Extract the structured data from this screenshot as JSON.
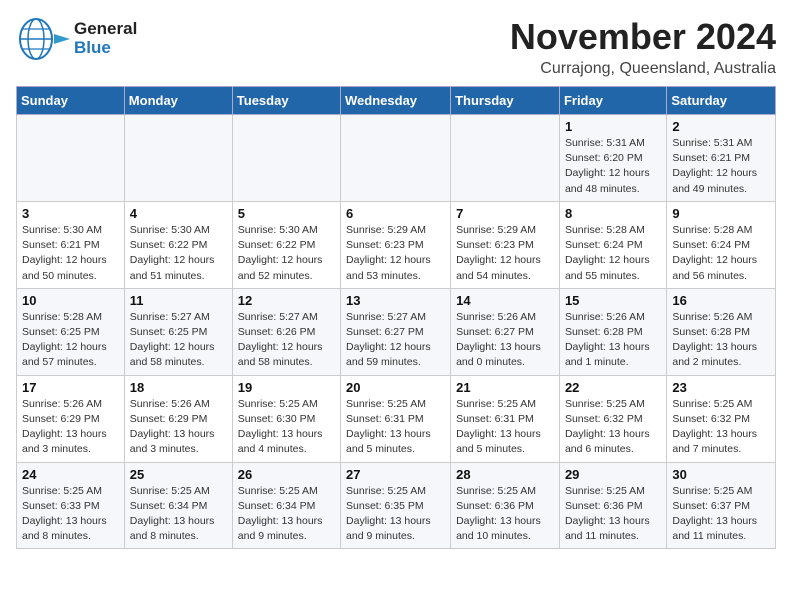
{
  "header": {
    "logo_general": "General",
    "logo_blue": "Blue",
    "month": "November 2024",
    "location": "Currajong, Queensland, Australia"
  },
  "weekdays": [
    "Sunday",
    "Monday",
    "Tuesday",
    "Wednesday",
    "Thursday",
    "Friday",
    "Saturday"
  ],
  "weeks": [
    [
      {
        "day": "",
        "info": ""
      },
      {
        "day": "",
        "info": ""
      },
      {
        "day": "",
        "info": ""
      },
      {
        "day": "",
        "info": ""
      },
      {
        "day": "",
        "info": ""
      },
      {
        "day": "1",
        "info": "Sunrise: 5:31 AM\nSunset: 6:20 PM\nDaylight: 12 hours\nand 48 minutes."
      },
      {
        "day": "2",
        "info": "Sunrise: 5:31 AM\nSunset: 6:21 PM\nDaylight: 12 hours\nand 49 minutes."
      }
    ],
    [
      {
        "day": "3",
        "info": "Sunrise: 5:30 AM\nSunset: 6:21 PM\nDaylight: 12 hours\nand 50 minutes."
      },
      {
        "day": "4",
        "info": "Sunrise: 5:30 AM\nSunset: 6:22 PM\nDaylight: 12 hours\nand 51 minutes."
      },
      {
        "day": "5",
        "info": "Sunrise: 5:30 AM\nSunset: 6:22 PM\nDaylight: 12 hours\nand 52 minutes."
      },
      {
        "day": "6",
        "info": "Sunrise: 5:29 AM\nSunset: 6:23 PM\nDaylight: 12 hours\nand 53 minutes."
      },
      {
        "day": "7",
        "info": "Sunrise: 5:29 AM\nSunset: 6:23 PM\nDaylight: 12 hours\nand 54 minutes."
      },
      {
        "day": "8",
        "info": "Sunrise: 5:28 AM\nSunset: 6:24 PM\nDaylight: 12 hours\nand 55 minutes."
      },
      {
        "day": "9",
        "info": "Sunrise: 5:28 AM\nSunset: 6:24 PM\nDaylight: 12 hours\nand 56 minutes."
      }
    ],
    [
      {
        "day": "10",
        "info": "Sunrise: 5:28 AM\nSunset: 6:25 PM\nDaylight: 12 hours\nand 57 minutes."
      },
      {
        "day": "11",
        "info": "Sunrise: 5:27 AM\nSunset: 6:25 PM\nDaylight: 12 hours\nand 58 minutes."
      },
      {
        "day": "12",
        "info": "Sunrise: 5:27 AM\nSunset: 6:26 PM\nDaylight: 12 hours\nand 58 minutes."
      },
      {
        "day": "13",
        "info": "Sunrise: 5:27 AM\nSunset: 6:27 PM\nDaylight: 12 hours\nand 59 minutes."
      },
      {
        "day": "14",
        "info": "Sunrise: 5:26 AM\nSunset: 6:27 PM\nDaylight: 13 hours\nand 0 minutes."
      },
      {
        "day": "15",
        "info": "Sunrise: 5:26 AM\nSunset: 6:28 PM\nDaylight: 13 hours\nand 1 minute."
      },
      {
        "day": "16",
        "info": "Sunrise: 5:26 AM\nSunset: 6:28 PM\nDaylight: 13 hours\nand 2 minutes."
      }
    ],
    [
      {
        "day": "17",
        "info": "Sunrise: 5:26 AM\nSunset: 6:29 PM\nDaylight: 13 hours\nand 3 minutes."
      },
      {
        "day": "18",
        "info": "Sunrise: 5:26 AM\nSunset: 6:29 PM\nDaylight: 13 hours\nand 3 minutes."
      },
      {
        "day": "19",
        "info": "Sunrise: 5:25 AM\nSunset: 6:30 PM\nDaylight: 13 hours\nand 4 minutes."
      },
      {
        "day": "20",
        "info": "Sunrise: 5:25 AM\nSunset: 6:31 PM\nDaylight: 13 hours\nand 5 minutes."
      },
      {
        "day": "21",
        "info": "Sunrise: 5:25 AM\nSunset: 6:31 PM\nDaylight: 13 hours\nand 5 minutes."
      },
      {
        "day": "22",
        "info": "Sunrise: 5:25 AM\nSunset: 6:32 PM\nDaylight: 13 hours\nand 6 minutes."
      },
      {
        "day": "23",
        "info": "Sunrise: 5:25 AM\nSunset: 6:32 PM\nDaylight: 13 hours\nand 7 minutes."
      }
    ],
    [
      {
        "day": "24",
        "info": "Sunrise: 5:25 AM\nSunset: 6:33 PM\nDaylight: 13 hours\nand 8 minutes."
      },
      {
        "day": "25",
        "info": "Sunrise: 5:25 AM\nSunset: 6:34 PM\nDaylight: 13 hours\nand 8 minutes."
      },
      {
        "day": "26",
        "info": "Sunrise: 5:25 AM\nSunset: 6:34 PM\nDaylight: 13 hours\nand 9 minutes."
      },
      {
        "day": "27",
        "info": "Sunrise: 5:25 AM\nSunset: 6:35 PM\nDaylight: 13 hours\nand 9 minutes."
      },
      {
        "day": "28",
        "info": "Sunrise: 5:25 AM\nSunset: 6:36 PM\nDaylight: 13 hours\nand 10 minutes."
      },
      {
        "day": "29",
        "info": "Sunrise: 5:25 AM\nSunset: 6:36 PM\nDaylight: 13 hours\nand 11 minutes."
      },
      {
        "day": "30",
        "info": "Sunrise: 5:25 AM\nSunset: 6:37 PM\nDaylight: 13 hours\nand 11 minutes."
      }
    ]
  ]
}
